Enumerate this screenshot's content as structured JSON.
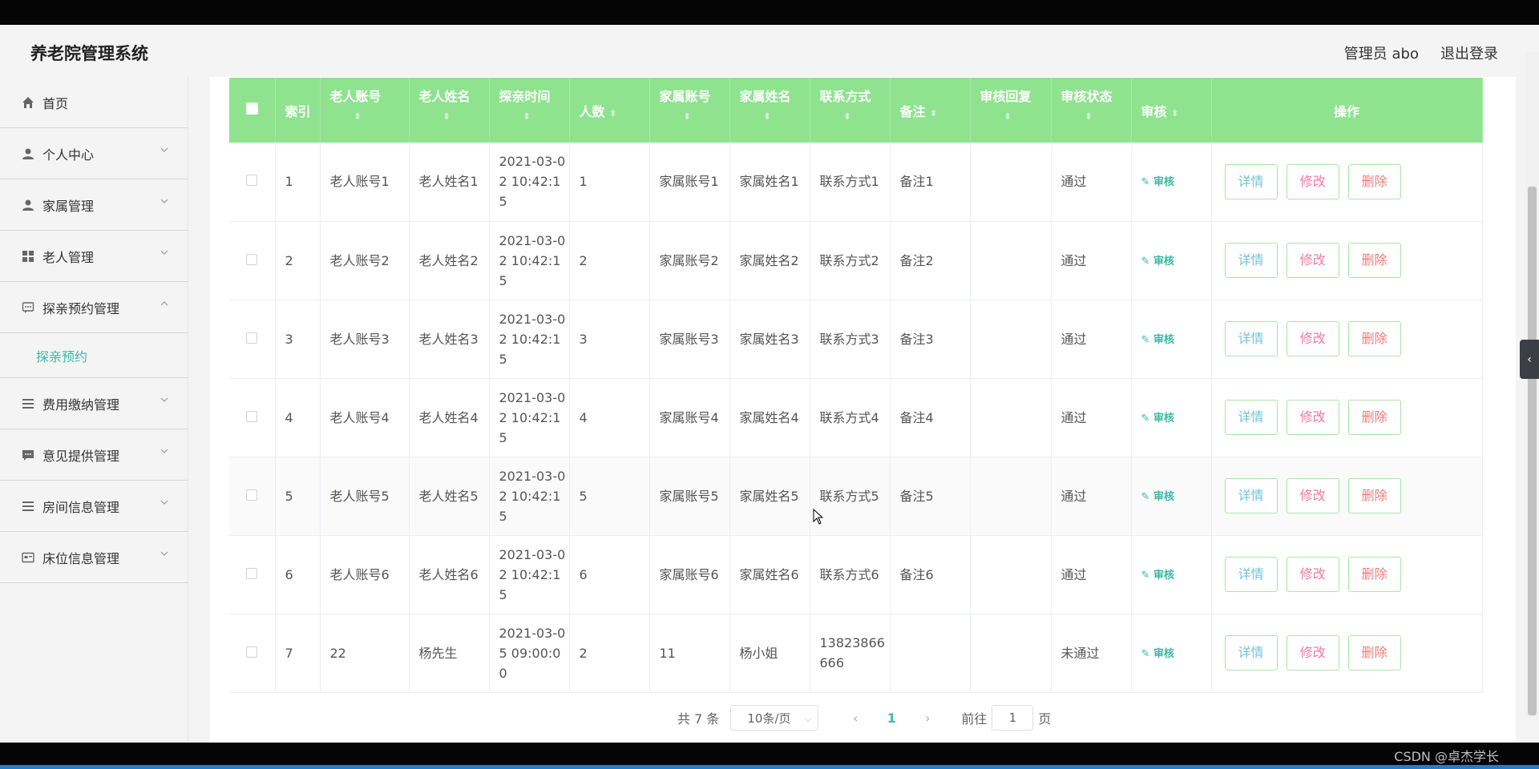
{
  "app": {
    "title": "养老院管理系统",
    "user": "管理员 abo",
    "logout": "退出登录"
  },
  "sidebar": {
    "items": [
      {
        "label": "首页",
        "icon": "home-icon"
      },
      {
        "label": "个人中心",
        "icon": "user-icon"
      },
      {
        "label": "家属管理",
        "icon": "user-icon"
      },
      {
        "label": "老人管理",
        "icon": "grid-icon"
      },
      {
        "label": "探亲预约管理",
        "icon": "chat-icon"
      },
      {
        "label": "费用缴纳管理",
        "icon": "list-icon"
      },
      {
        "label": "意见提供管理",
        "icon": "message-icon"
      },
      {
        "label": "房间信息管理",
        "icon": "list-icon"
      },
      {
        "label": "床位信息管理",
        "icon": "card-icon"
      }
    ],
    "submenu_active": "探亲预约"
  },
  "table": {
    "headers": {
      "index": "索引",
      "elder_account": "老人账号",
      "elder_name": "老人姓名",
      "visit_time": "探亲时间",
      "count": "人数",
      "family_account": "家属账号",
      "family_name": "家属姓名",
      "contact": "联系方式",
      "remark": "备注",
      "review_reply": "审核回复",
      "review_status": "审核状态",
      "review": "审核",
      "actions": "操作"
    },
    "rows": [
      {
        "index": "1",
        "elder_account": "老人账号1",
        "elder_name": "老人姓名1",
        "visit_time": "2021-03-02 10:42:15",
        "count": "1",
        "family_account": "家属账号1",
        "family_name": "家属姓名1",
        "contact": "联系方式1",
        "remark": "备注1",
        "review_reply": "",
        "review_status": "通过"
      },
      {
        "index": "2",
        "elder_account": "老人账号2",
        "elder_name": "老人姓名2",
        "visit_time": "2021-03-02 10:42:15",
        "count": "2",
        "family_account": "家属账号2",
        "family_name": "家属姓名2",
        "contact": "联系方式2",
        "remark": "备注2",
        "review_reply": "",
        "review_status": "通过"
      },
      {
        "index": "3",
        "elder_account": "老人账号3",
        "elder_name": "老人姓名3",
        "visit_time": "2021-03-02 10:42:15",
        "count": "3",
        "family_account": "家属账号3",
        "family_name": "家属姓名3",
        "contact": "联系方式3",
        "remark": "备注3",
        "review_reply": "",
        "review_status": "通过"
      },
      {
        "index": "4",
        "elder_account": "老人账号4",
        "elder_name": "老人姓名4",
        "visit_time": "2021-03-02 10:42:15",
        "count": "4",
        "family_account": "家属账号4",
        "family_name": "家属姓名4",
        "contact": "联系方式4",
        "remark": "备注4",
        "review_reply": "",
        "review_status": "通过"
      },
      {
        "index": "5",
        "elder_account": "老人账号5",
        "elder_name": "老人姓名5",
        "visit_time": "2021-03-02 10:42:15",
        "count": "5",
        "family_account": "家属账号5",
        "family_name": "家属姓名5",
        "contact": "联系方式5",
        "remark": "备注5",
        "review_reply": "",
        "review_status": "通过"
      },
      {
        "index": "6",
        "elder_account": "老人账号6",
        "elder_name": "老人姓名6",
        "visit_time": "2021-03-02 10:42:15",
        "count": "6",
        "family_account": "家属账号6",
        "family_name": "家属姓名6",
        "contact": "联系方式6",
        "remark": "备注6",
        "review_reply": "",
        "review_status": "通过"
      },
      {
        "index": "7",
        "elder_account": "22",
        "elder_name": "杨先生",
        "visit_time": "2021-03-05 09:00:00",
        "count": "2",
        "family_account": "11",
        "family_name": "杨小姐",
        "contact": "13823866666",
        "remark": "",
        "review_reply": "",
        "review_status": "未通过"
      }
    ],
    "audit_label": "审核",
    "btn_detail": "详情",
    "btn_edit": "修改",
    "btn_delete": "删除"
  },
  "pagination": {
    "total": "共 7 条",
    "page_size": "10条/页",
    "current_page": "1",
    "goto_prefix": "前往",
    "goto_value": "1",
    "goto_suffix": "页"
  },
  "footer": {
    "watermark": "CSDN @卓杰学长"
  },
  "colors": {
    "header_green": "#8fe38f",
    "accent_teal": "#3bb8a3",
    "edit_pink": "#f07aa3",
    "delete_red": "#f07a7a"
  }
}
